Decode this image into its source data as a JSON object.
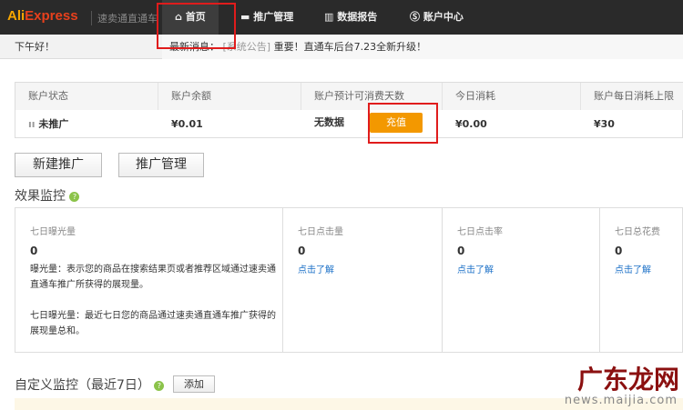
{
  "header": {
    "logo": "AliExpress",
    "logo_ali": "Ali",
    "logo_rest": "Express",
    "subtitle": "速卖通直通车",
    "nav": [
      {
        "label": "首页",
        "icon": "home-icon",
        "active": true
      },
      {
        "label": "推广管理",
        "icon": "briefcase-icon"
      },
      {
        "label": "数据报告",
        "icon": "bar-chart-icon"
      },
      {
        "label": "账户中心",
        "icon": "dollar-icon"
      }
    ]
  },
  "subbar": {
    "greeting": "下午好！",
    "notice_label": "最新消息：",
    "notice_tag": "[系统公告]",
    "notice_text": "重要！直通车后台7.23全新升级！"
  },
  "account": {
    "headers": [
      "账户状态",
      "账户余额",
      "账户预计可消费天数",
      "今日消耗",
      "账户每日消耗上限"
    ],
    "values": [
      "未推广",
      "¥0.01",
      "无数据",
      "¥0.00",
      "¥30"
    ],
    "status_icon": "pause-icon",
    "charge_button": "充值"
  },
  "actions": {
    "new_promo": "新建推广",
    "promo_manage": "推广管理"
  },
  "monitor": {
    "title": "效果监控",
    "cards": [
      {
        "label": "七日曝光量",
        "value": "0",
        "desc1": "曝光量：表示您的商品在搜索结果页或者推荐区域通过速卖通直通车推广所获得的展现量。",
        "desc2": "七日曝光量：最近七日您的商品通过速卖通直通车推广获得的展现量总和。"
      },
      {
        "label": "七日点击量",
        "value": "0",
        "link": "点击了解"
      },
      {
        "label": "七日点击率",
        "value": "0",
        "link": "点击了解"
      },
      {
        "label": "七日总花费",
        "value": "0",
        "link": "点击了解"
      }
    ]
  },
  "custom": {
    "title": "自定义监控（最近7日）",
    "add": "添加"
  },
  "watermark": {
    "text": "广东龙网",
    "url": "news.maijia.com"
  }
}
